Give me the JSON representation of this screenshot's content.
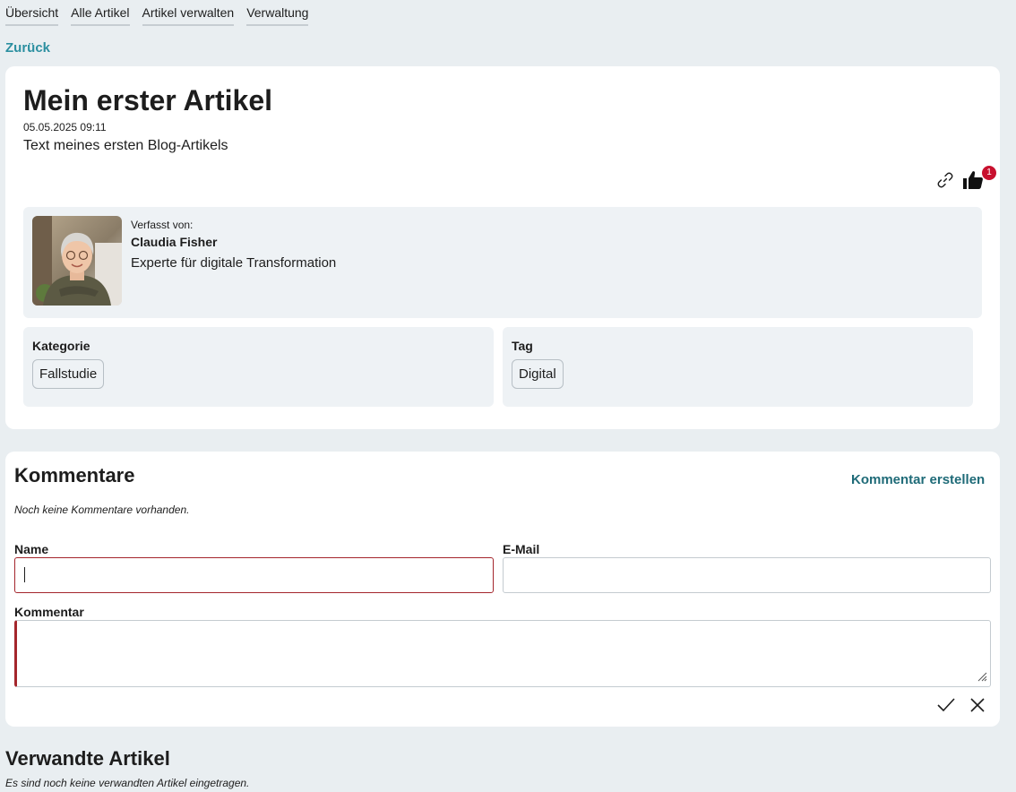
{
  "nav": {
    "items": [
      {
        "label": "Übersicht"
      },
      {
        "label": "Alle Artikel"
      },
      {
        "label": "Artikel verwalten"
      },
      {
        "label": "Verwaltung"
      }
    ]
  },
  "back_label": "Zurück",
  "article": {
    "title": "Mein erster Artikel",
    "date": "05.05.2025 09:11",
    "text": "Text meines ersten Blog-Artikels",
    "link_icon": "link-icon",
    "like_icon": "thumbs-up-icon",
    "like_count": "1",
    "author": {
      "by_label": "Verfasst von:",
      "name": "Claudia Fisher",
      "role": "Experte für digitale Transformation"
    },
    "category": {
      "label": "Kategorie",
      "value": "Fallstudie"
    },
    "tag": {
      "label": "Tag",
      "value": "Digital"
    }
  },
  "comments": {
    "title": "Kommentare",
    "create_label": "Kommentar erstellen",
    "empty_text": "Noch keine Kommentare vorhanden.",
    "form": {
      "name_label": "Name",
      "name_value": "",
      "email_label": "E-Mail",
      "email_value": "",
      "comment_label": "Kommentar",
      "comment_value": ""
    }
  },
  "related": {
    "title": "Verwandte Artikel",
    "empty_text": "Es sind noch keine verwandten Artikel eingetragen."
  },
  "colors": {
    "background": "#e9eef1",
    "accent": "#2b8fa0",
    "badge": "#c8102e",
    "invalid": "#a4262c"
  }
}
